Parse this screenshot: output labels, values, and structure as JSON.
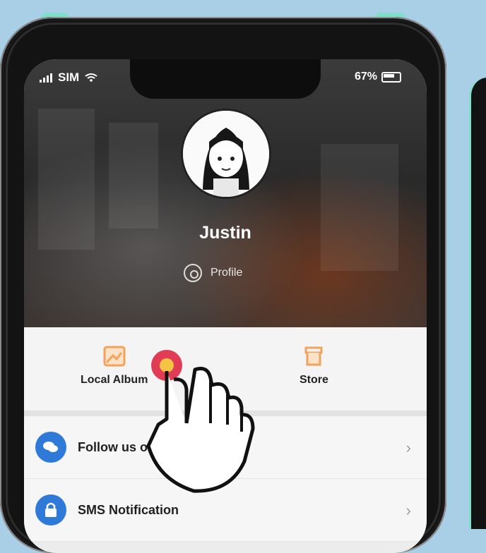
{
  "status_bar": {
    "carrier": "SIM",
    "battery_pct": "67%"
  },
  "profile": {
    "name": "Justin",
    "profile_label": "Profile"
  },
  "tabs": [
    {
      "label": "Local Album"
    },
    {
      "label": "Store"
    }
  ],
  "menu": [
    {
      "label": "Follow us on",
      "icon": "chat-icon"
    },
    {
      "label": "SMS Notification",
      "icon": "lock-icon"
    }
  ],
  "colors": {
    "accent_blue": "#2f7ad8",
    "tap_indicator": "#e13c55",
    "icon_orange": "#f0a35b"
  }
}
